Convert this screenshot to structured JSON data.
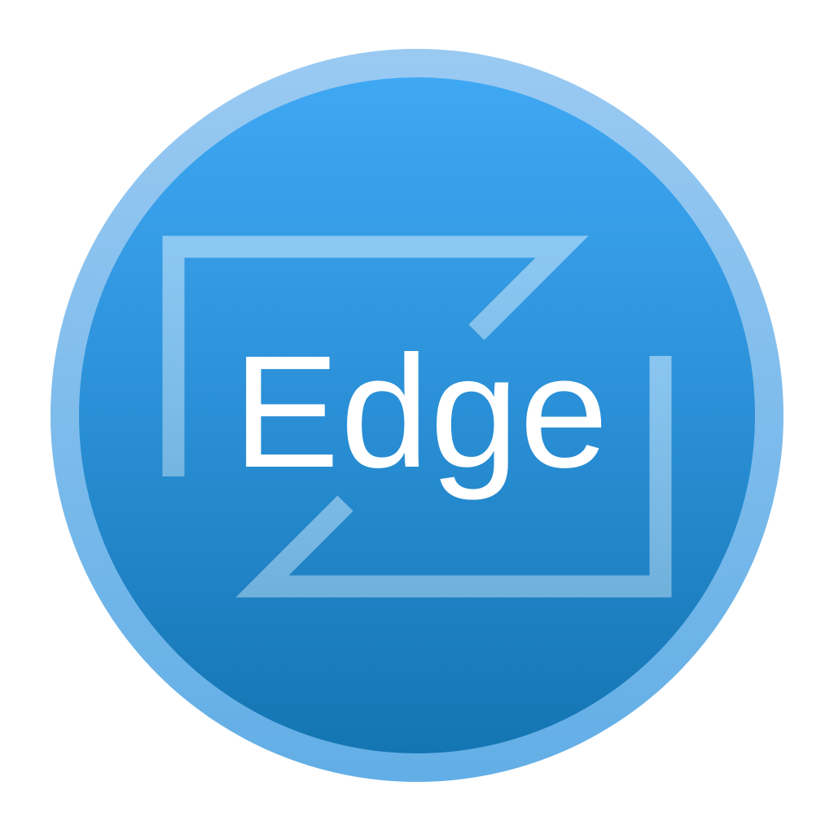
{
  "app_icon": {
    "label": "Edge",
    "icon": "edge-app-logo-icon",
    "colors": {
      "rim": "#8ec4f1",
      "face_top": "#3fa7f3",
      "face_bottom": "#1478b6",
      "frame_stroke": "#8fc9f2",
      "label": "#ffffff"
    }
  }
}
